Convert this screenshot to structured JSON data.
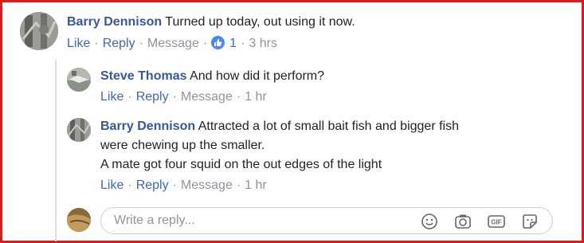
{
  "comments": [
    {
      "author": "Barry Dennison",
      "text": "Turned up today, out using it now.",
      "actions": {
        "like": "Like",
        "reply": "Reply",
        "message": "Message",
        "reactions": "1",
        "time": "3 hrs"
      }
    }
  ],
  "replies": [
    {
      "author": "Steve Thomas",
      "text": "And how did it perform?",
      "actions": {
        "like": "Like",
        "reply": "Reply",
        "message": "Message",
        "time": "1 hr"
      }
    },
    {
      "author": "Barry Dennison",
      "text_lines": [
        "Attracted a lot of small bait fish and bigger fish",
        "were chewing up the smaller.",
        "A mate got four squid on the out edges of the light"
      ],
      "actions": {
        "like": "Like",
        "reply": "Reply",
        "message": "Message",
        "time": "1 hr"
      }
    }
  ],
  "reply_box": {
    "placeholder": "Write a reply...",
    "icons": [
      "emoji-icon",
      "camera-icon",
      "gif-icon",
      "sticker-icon"
    ]
  },
  "colors": {
    "author": "#385898",
    "link": "#4267b2",
    "meta": "#90949c",
    "like_badge": "#4d86f7",
    "frame": "#e0191c"
  },
  "separator": "·"
}
